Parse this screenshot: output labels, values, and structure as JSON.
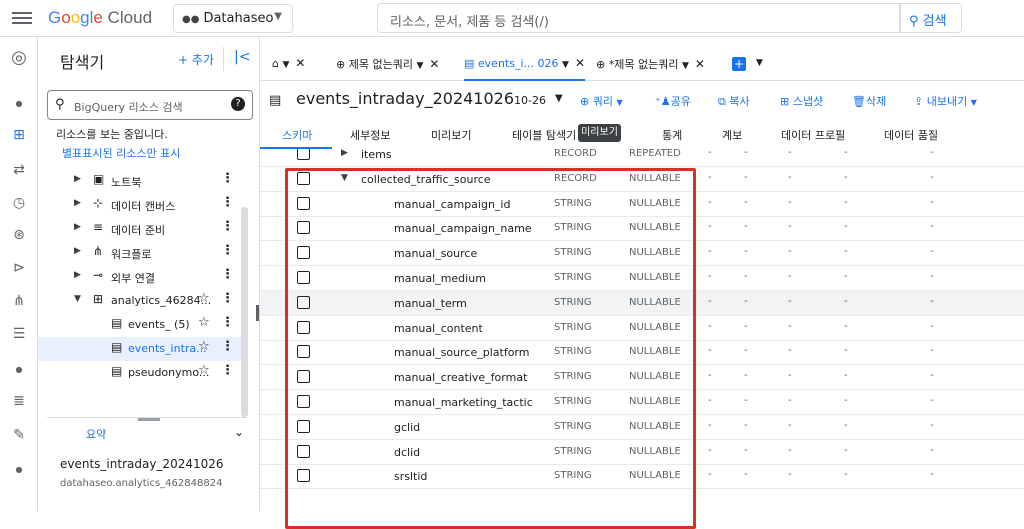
{
  "topbar": {
    "logo_letters": [
      "G",
      "o",
      "o",
      "g",
      "l",
      "e"
    ],
    "logo_suffix": "Cloud",
    "project": "Datahaseo",
    "search_placeholder": "리소스, 문서, 제품 등 검색(/)",
    "search_button": "검색"
  },
  "rail": {
    "icons": [
      "bigquery-logo-icon",
      "dot-icon",
      "dashboard-icon",
      "transfer-icon",
      "schedule-icon",
      "analytics-icon",
      "pipeline-icon",
      "workflow-icon",
      "list-icon",
      "dot-icon",
      "menu-list-icon",
      "wrench-icon",
      "dot-icon"
    ]
  },
  "explorer": {
    "title": "탐색기",
    "add": "+ 추가",
    "search_placeholder": "BigQuery 리소스 검색",
    "info": "리소스를 보는 중입니다.",
    "starred_link": "별표표시된 리소스만 표시",
    "items": [
      {
        "label": "노트북"
      },
      {
        "label": "데이터 캔버스"
      },
      {
        "label": "데이터 준비"
      },
      {
        "label": "워크플로"
      },
      {
        "label": "외부 연결"
      },
      {
        "label": "analytics_46284..."
      },
      {
        "label": "events_ (5)"
      },
      {
        "label": "events_intra..."
      },
      {
        "label": "pseudonymo..."
      }
    ],
    "summary_label": "요약",
    "summary_name": "events_intraday_20241026",
    "summary_path": "datahaseo.analytics_462848824"
  },
  "tabs": [
    {
      "label": "⌂"
    },
    {
      "label": "제목 없는쿼리"
    },
    {
      "label": "events_i... 026"
    },
    {
      "label": "*제목 없는쿼리"
    }
  ],
  "header": {
    "title": "events_intraday_20241026",
    "date": "10-26",
    "actions": [
      "쿼리",
      "공유",
      "복사",
      "스냅샷",
      "삭제",
      "내보내기"
    ]
  },
  "subtabs": [
    "스키마",
    "세부정보",
    "미리보기",
    "테이블 탐색기",
    "통계",
    "계보",
    "데이터 프로필",
    "데이터 품질"
  ],
  "tooltip": "미리보기",
  "schema": {
    "rows": [
      {
        "name": "items",
        "type": "RECORD",
        "mode": "REPEATED"
      },
      {
        "name": "collected_traffic_source",
        "type": "RECORD",
        "mode": "NULLABLE"
      },
      {
        "name": "manual_campaign_id",
        "type": "STRING",
        "mode": "NULLABLE"
      },
      {
        "name": "manual_campaign_name",
        "type": "STRING",
        "mode": "NULLABLE"
      },
      {
        "name": "manual_source",
        "type": "STRING",
        "mode": "NULLABLE"
      },
      {
        "name": "manual_medium",
        "type": "STRING",
        "mode": "NULLABLE"
      },
      {
        "name": "manual_term",
        "type": "STRING",
        "mode": "NULLABLE"
      },
      {
        "name": "manual_content",
        "type": "STRING",
        "mode": "NULLABLE"
      },
      {
        "name": "manual_source_platform",
        "type": "STRING",
        "mode": "NULLABLE"
      },
      {
        "name": "manual_creative_format",
        "type": "STRING",
        "mode": "NULLABLE"
      },
      {
        "name": "manual_marketing_tactic",
        "type": "STRING",
        "mode": "NULLABLE"
      },
      {
        "name": "gclid",
        "type": "STRING",
        "mode": "NULLABLE"
      },
      {
        "name": "dclid",
        "type": "STRING",
        "mode": "NULLABLE"
      },
      {
        "name": "srsltid",
        "type": "STRING",
        "mode": "NULLABLE"
      }
    ],
    "dash": "-"
  },
  "colors": {
    "accent": "#1a73e8",
    "highlight": "#d93025"
  }
}
